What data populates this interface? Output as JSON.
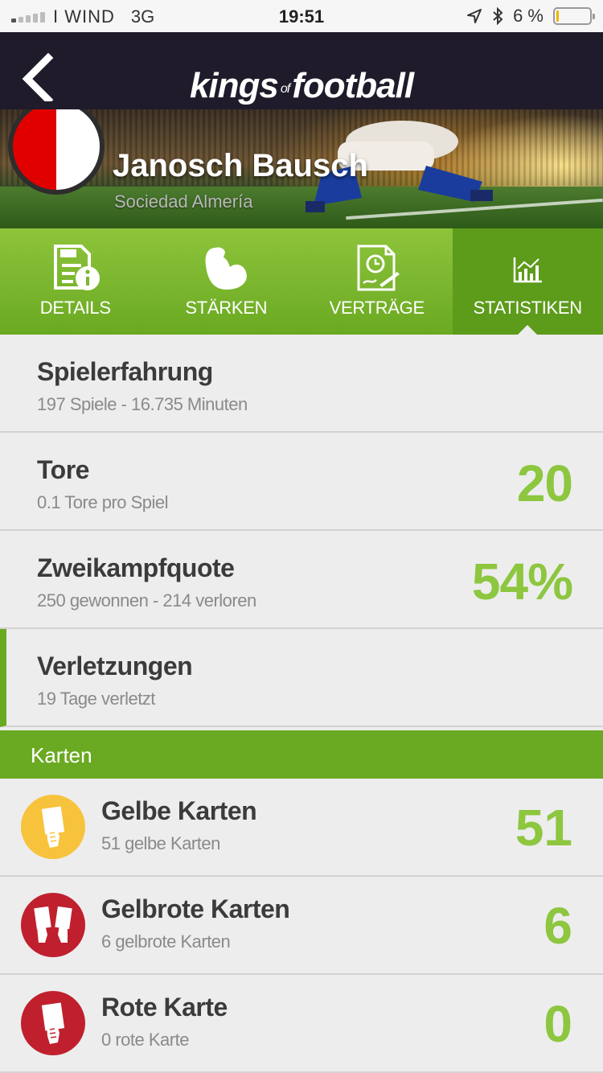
{
  "status_bar": {
    "carrier": "I WIND",
    "network": "3G",
    "time": "19:51",
    "battery_text": "6 %",
    "battery_level": 0.06
  },
  "nav": {
    "back_icon": "chevron-left-icon",
    "logo_part1": "kings",
    "logo_of": "of",
    "logo_part2": "football"
  },
  "player": {
    "name": "Janosch Bausch",
    "club": "Sociedad Almería",
    "crest_colors": [
      "#e00000",
      "#ffffff"
    ]
  },
  "tabs": [
    {
      "label": "DETAILS",
      "icon": "document-info-icon",
      "active": false
    },
    {
      "label": "STÄRKEN",
      "icon": "flexed-arm-icon",
      "active": false
    },
    {
      "label": "VERTRÄGE",
      "icon": "contract-icon",
      "active": false
    },
    {
      "label": "STATISTIKEN",
      "icon": "chart-icon",
      "active": true
    }
  ],
  "stats": [
    {
      "title": "Spielerfahrung",
      "subtitle": "197 Spiele - 16.735 Minuten",
      "value": ""
    },
    {
      "title": "Tore",
      "subtitle": "0.1 Tore pro Spiel",
      "value": "20"
    },
    {
      "title": "Zweikampfquote",
      "subtitle": "250 gewonnen - 214 verloren",
      "value": "54%"
    },
    {
      "title": "Verletzungen",
      "subtitle": "19 Tage verletzt",
      "value": ""
    }
  ],
  "cards_section": {
    "title": "Karten",
    "items": [
      {
        "title": "Gelbe Karten",
        "subtitle": "51 gelbe Karten",
        "value": "51",
        "icon": "yellow-card-icon",
        "color": "#f7c33c"
      },
      {
        "title": "Gelbrote Karten",
        "subtitle": "6 gelbrote Karten",
        "value": "6",
        "icon": "yellow-red-card-icon",
        "color": "#c0202e"
      },
      {
        "title": "Rote Karte",
        "subtitle": "0 rote Karte",
        "value": "0",
        "icon": "red-card-icon",
        "color": "#c0202e"
      }
    ]
  },
  "colors": {
    "accent_green": "#6aa922",
    "value_green": "#8dc63f",
    "nav_dark": "#1f1b2a"
  }
}
